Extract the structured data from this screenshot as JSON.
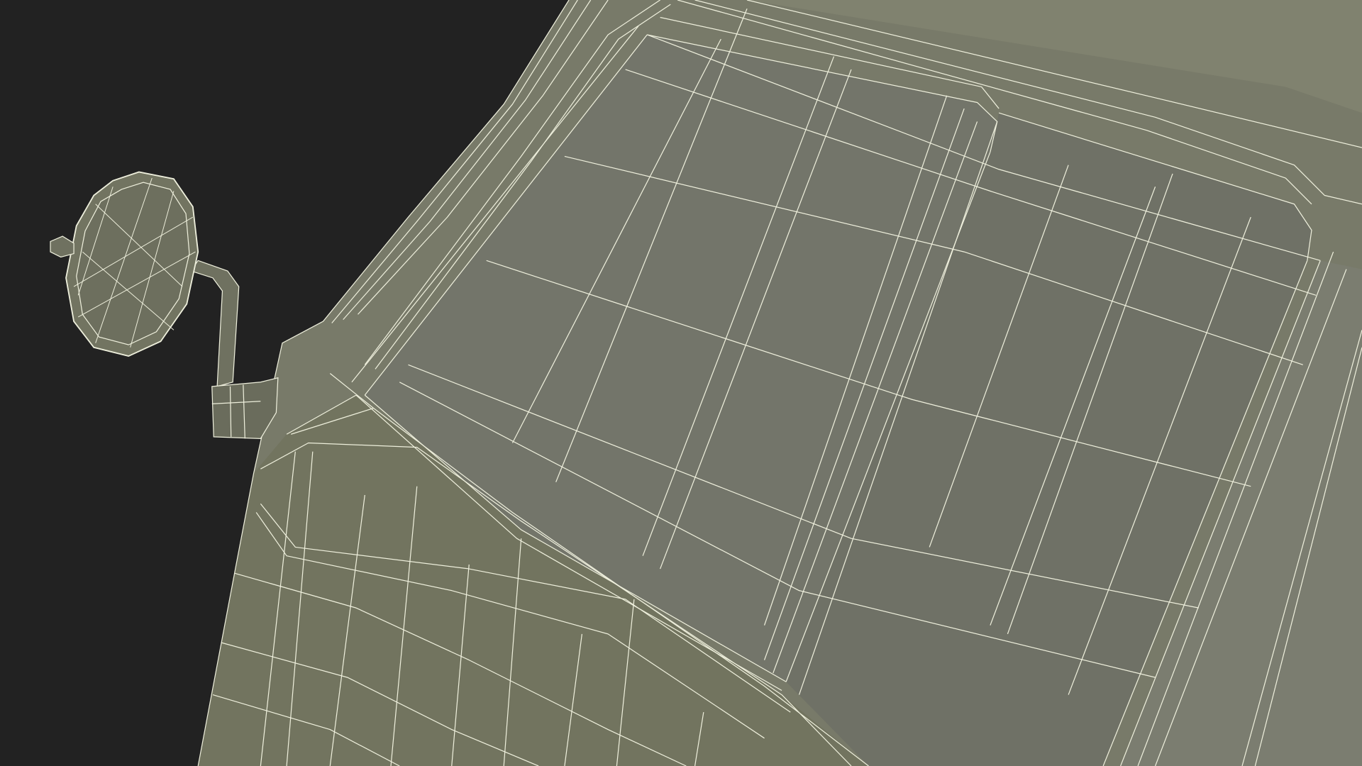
{
  "scene": {
    "subject": "wireframe-render",
    "colors": {
      "background": "#222222",
      "surface": "#787a69",
      "surface_shade": "#6c6e5d",
      "surface_light": "#84867a",
      "wire": "#eeefdc"
    }
  }
}
